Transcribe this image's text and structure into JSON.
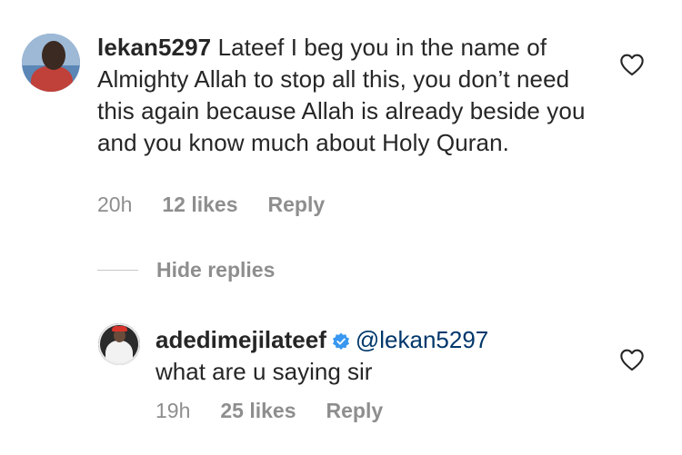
{
  "comments": [
    {
      "username": "lekan5297",
      "text": "Lateef I beg you in the name of Almighty Allah to stop all this, you don’t need this again because Allah is already beside you and you know much about Holy Quran.",
      "time": "20h",
      "likes": "12 likes",
      "reply_label": "Reply"
    }
  ],
  "hide_replies_label": "Hide replies",
  "reply": {
    "username": "adedimejilateef",
    "verified": true,
    "mention": "@lekan5297",
    "text": "what are u saying sir",
    "time": "19h",
    "likes": "25 likes",
    "reply_label": "Reply"
  },
  "icons": {
    "like": "heart-icon",
    "verified": "verified-badge-icon"
  },
  "colors": {
    "text": "#262626",
    "secondary": "#8e8e8e",
    "mention": "#00376b",
    "verified": "#3897f0"
  }
}
